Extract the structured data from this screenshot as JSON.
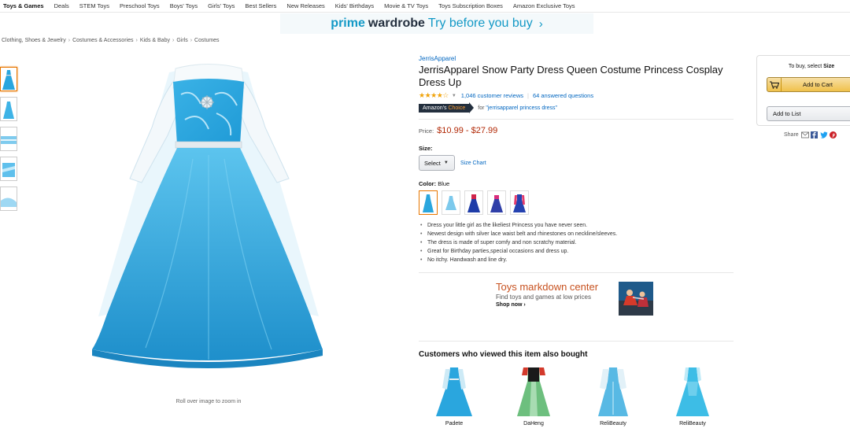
{
  "nav": {
    "items": [
      "Toys & Games",
      "Deals",
      "STEM Toys",
      "Preschool Toys",
      "Boys' Toys",
      "Girls' Toys",
      "Best Sellers",
      "New Releases",
      "Kids' Birthdays",
      "Movie & TV Toys",
      "Toys Subscription Boxes",
      "Amazon Exclusive Toys"
    ]
  },
  "banner": {
    "word1": "prime",
    "word2": "wardrobe",
    "word3": "Try before you buy",
    "arrow": "›"
  },
  "breadcrumb": [
    "Clothing, Shoes & Jewelry",
    "Costumes & Accessories",
    "Kids & Baby",
    "Girls",
    "Costumes"
  ],
  "breadcrumb_sep": "›",
  "gallery": {
    "zoom_hint": "Roll over image to zoom in",
    "thumb_count": 5
  },
  "product": {
    "brand": "JerrisApparel",
    "title": "JerrisApparel Snow Party Dress Queen Costume Princess Cosplay Dress Up",
    "stars": "★★★★☆",
    "rating": 4.5,
    "reviews": "1,046 customer reviews",
    "questions": "64 answered questions",
    "choice_amazon": "Amazon's",
    "choice_word": "Choice",
    "choice_for": "for",
    "choice_query": "\"jerrisapparel princess dress\"",
    "price_label": "Price:",
    "price": "$10.99 - $27.99",
    "size_label": "Size:",
    "size_select": "Select",
    "size_chart": "Size Chart",
    "color_label": "Color:",
    "color_value": "Blue",
    "bullets": [
      "Dress your little girl as the likeliest Princess you have never seen.",
      "Newest design with silver lace waist belt and rhinestones on neckline/sleeves.",
      "The dress is made of super comfy and non scratchy material.",
      "Great for Birthday parties,special occasions and dress up.",
      "No itchy. Handwash and line dry."
    ]
  },
  "ad": {
    "title": "Toys markdown center",
    "subtitle": "Find toys and games at low prices",
    "cta": "Shop now ›"
  },
  "also_bought": {
    "heading": "Customers who viewed this item also bought",
    "items": [
      {
        "name": "Padete"
      },
      {
        "name": "DaHeng"
      },
      {
        "name": "ReliBeauty"
      },
      {
        "name": "ReliBeauty"
      }
    ]
  },
  "buybox": {
    "to_buy": "To buy, select",
    "to_buy_bold": "Size",
    "add_to_cart": "Add to Cart",
    "add_to_list": "Add to List",
    "share": "Share"
  },
  "colors": {
    "link": "#0066c0",
    "price": "#b12704",
    "accent": "#e77600",
    "prime": "#1399c6",
    "dress_blue": "#2aa6de"
  }
}
